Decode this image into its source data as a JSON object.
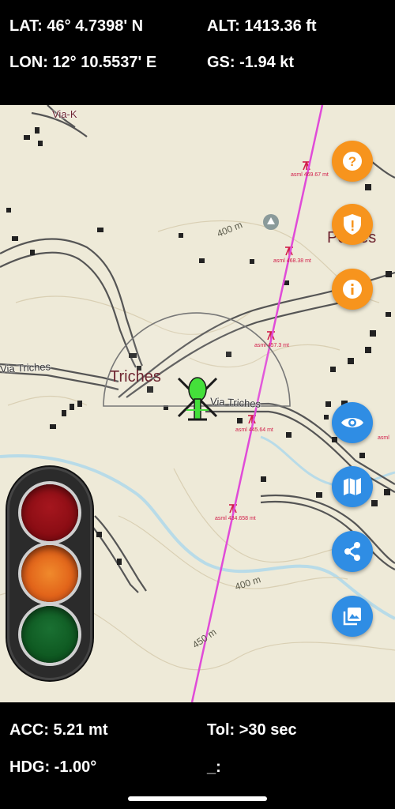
{
  "telemetry": {
    "lat": "LAT: 46° 4.7398' N",
    "alt": "ALT: 1413.36 ft",
    "lon": "LON: 12° 10.5537' E",
    "gs": "GS: -1.94 kt",
    "acc": "ACC: 5.21 mt",
    "tol": "Tol: >30 sec",
    "hdg": "HDG: -1.00°",
    "extra": "_:"
  },
  "map": {
    "places": {
      "triches": "Triches",
      "poutes": "Pontes"
    },
    "roads": {
      "via_triches_left": "Via Triches",
      "via_triches_right": "Via Triches",
      "via_top": "Via-K"
    },
    "contours": {
      "c400_top": "400 m",
      "c400_bottom": "400 m",
      "c450": "450 m"
    },
    "obstacles": [
      {
        "label": "asml 469.67 mt"
      },
      {
        "label": "asml 468.38 mt"
      },
      {
        "label": "asml 457.3 mt"
      },
      {
        "label": "asml 445.64 mt"
      },
      {
        "label": "asml 434.658 mt"
      },
      {
        "label": "asml"
      }
    ]
  },
  "buttons": {
    "help": "help-icon",
    "shield": "shield-icon",
    "info": "info-icon",
    "visibility": "eye-icon",
    "map": "map-icon",
    "share": "share-icon",
    "gallery": "gallery-icon"
  },
  "traffic_light": {
    "red": "#8b0d14",
    "amber": "#e2641a",
    "green": "#0f5a22"
  },
  "colors": {
    "orange_button": "#f7941d",
    "blue_button": "#2f8de4",
    "track_line": "#e04bd8",
    "aircraft": "#44e03a",
    "map_background": "#eeead8"
  }
}
